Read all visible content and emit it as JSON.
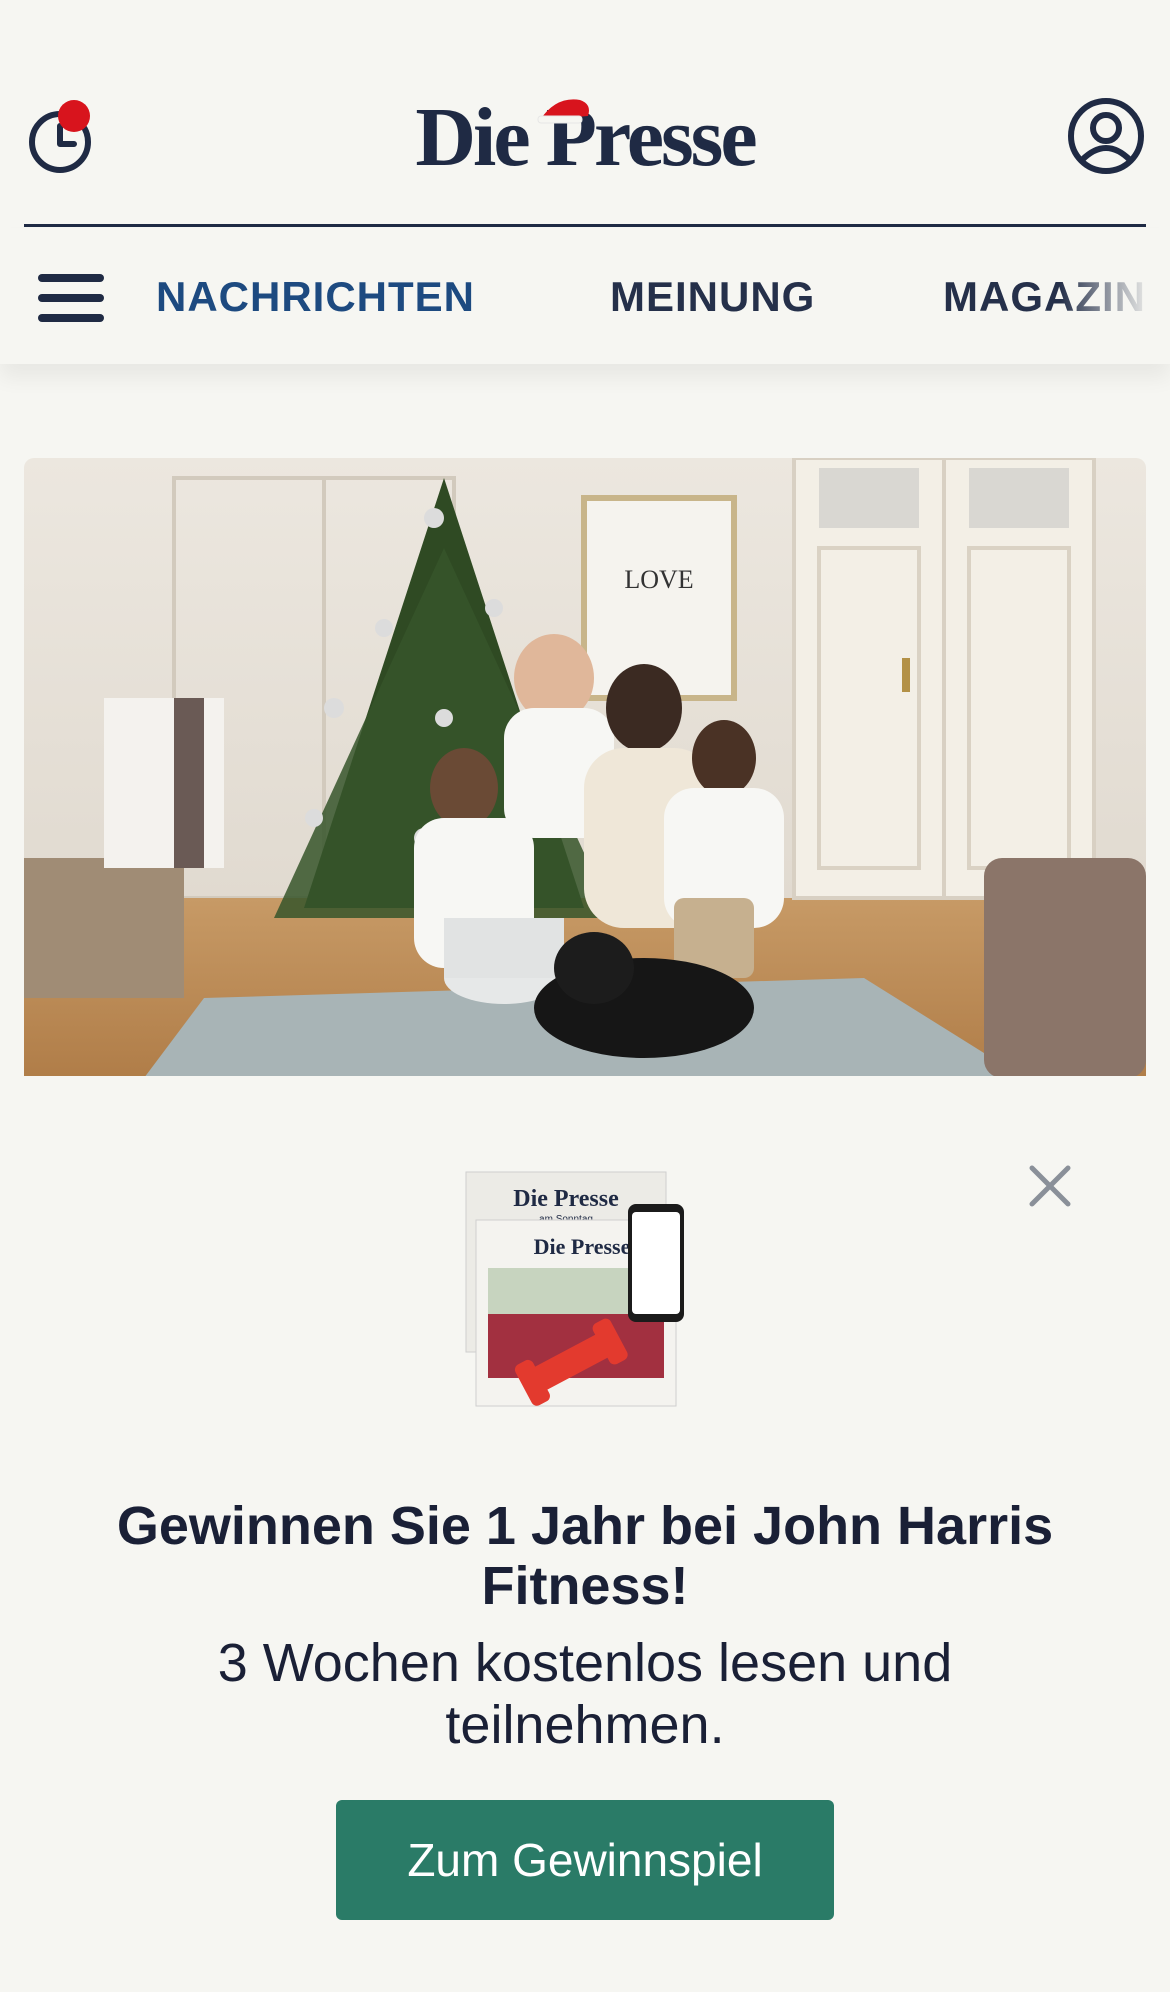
{
  "header": {
    "logo_text": "Die Presse"
  },
  "nav": {
    "items": [
      {
        "label": "NACHRICHTEN",
        "active": true
      },
      {
        "label": "MEINUNG",
        "active": false
      },
      {
        "label": "MAGAZIN",
        "active": false
      }
    ]
  },
  "promo": {
    "image_papers": {
      "sunday_title": "Die Presse",
      "sunday_subtitle": "am Sonntag",
      "daily_title": "Die Presse"
    },
    "title": "Gewinnen Sie 1 Jahr bei John Harris Fitness!",
    "subtitle": "3 Wochen kostenlos lesen und teilnehmen.",
    "cta_label": "Zum Gewinnspiel"
  },
  "colors": {
    "background": "#f6f6f2",
    "brand_navy": "#1f2a44",
    "nav_active": "#1d4a80",
    "notification": "#d8141d",
    "cta": "#2a7b67"
  },
  "icons": {
    "history": "clock-icon",
    "account": "user-icon",
    "menu": "hamburger-icon",
    "close": "close-icon"
  }
}
